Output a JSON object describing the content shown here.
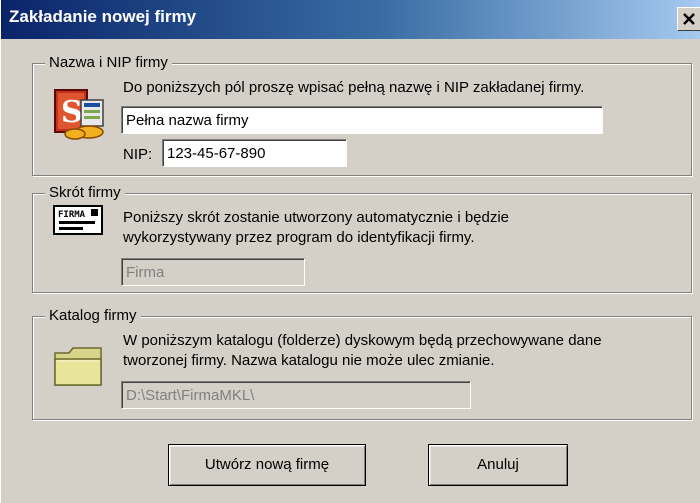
{
  "window": {
    "title": "Zakładanie nowej firmy"
  },
  "section_name": {
    "legend": "Nazwa i NIP firmy",
    "description": "Do poniższych pól proszę wpisać pełną nazwę i NIP zakładanej firmy.",
    "name_value": "Pełna nazwa firmy",
    "nip_label": "NIP:",
    "nip_value": "123-45-67-890"
  },
  "section_short": {
    "legend": "Skrót firmy",
    "description_line1": "Poniższy skrót zostanie utworzony automatycznie i będzie",
    "description_line2": "wykorzystywany przez program do identyfikacji firmy.",
    "short_value": "Firma",
    "icon_label": "FIRMA"
  },
  "section_folder": {
    "legend": "Katalog firmy",
    "description_line1": "W poniższym katalogu (folderze) dyskowym będą przechowywane dane",
    "description_line2": "tworzonej firmy. Nazwa katalogu nie może ulec zmianie.",
    "path_value": "D:\\Start\\FirmaMKL\\"
  },
  "buttons": {
    "create": "Utwórz nową firmę",
    "cancel": "Anuluj"
  },
  "icons": {
    "close": "close-icon",
    "company": "company-app-icon",
    "short_name": "name-card-icon",
    "folder": "folder-icon"
  }
}
